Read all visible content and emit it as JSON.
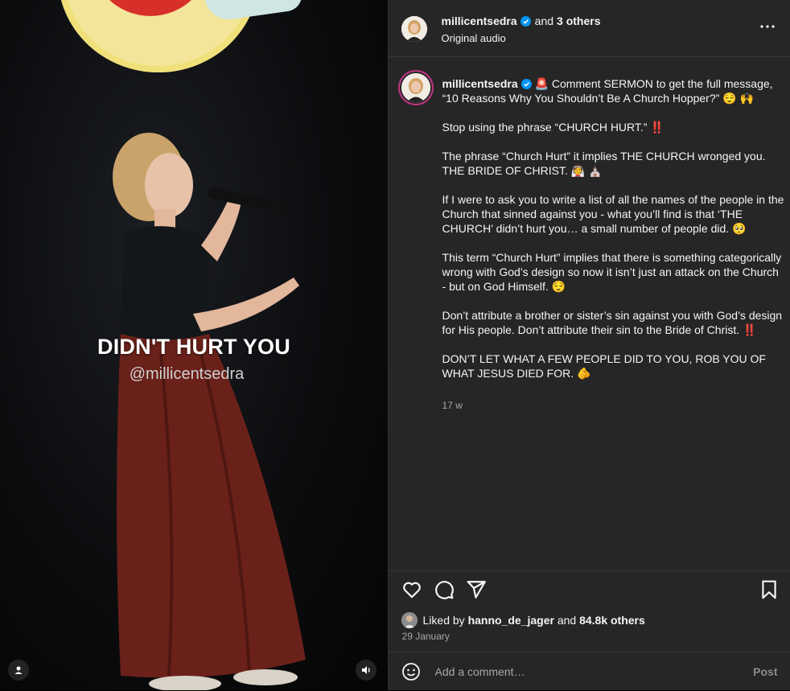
{
  "video": {
    "overlay_title": "DIDN'T HURT YOU",
    "overlay_handle": "@millicentsedra",
    "icons": [
      "user-tag-icon",
      "sound-icon"
    ]
  },
  "header": {
    "username": "millicentsedra",
    "and_text": "and",
    "others": "3 others",
    "audio": "Original audio"
  },
  "caption": {
    "username": "millicentsedra",
    "lines": [
      "🚨 Comment SERMON to get the full message, “10 Reasons Why You Shouldn’t Be A Church Hopper?” 😌 🙌",
      "Stop using the phrase “CHURCH HURT.” ‼️",
      "The phrase “Church Hurt” it implies THE CHURCH wronged you. THE BRIDE OF CHRIST. 👰 ⛪",
      "If I were to ask you to write a list of all the names of the people in the Church that sinned against you - what you’ll find is that ‘THE CHURCH’ didn’t hurt you… a small number of people did. 🥺",
      "This term “Church Hurt” implies that there is something categorically wrong with God’s design so now it isn’t just an attack on the Church - but on God Himself. 😌",
      "Don’t attribute a brother or sister’s sin against you with God’s design for His people. Don’t attribute their sin to the Bride of Christ. ‼️",
      "DON’T LET WHAT A FEW PEOPLE DID TO YOU, ROB YOU OF WHAT JESUS DIED FOR. 🫵"
    ],
    "time_ago": "17 w"
  },
  "actions": {
    "liked_by": "Liked by",
    "liker": "hanno_de_jager",
    "and_text": "and",
    "likes_count": "84.8k others",
    "date": "29 January"
  },
  "comment": {
    "placeholder": "Add a comment…",
    "post_label": "Post"
  },
  "colors": {
    "panel_bg": "#262626",
    "verified": "#0095f6",
    "text": "#f5f5f5",
    "muted": "#a8a8a8"
  }
}
